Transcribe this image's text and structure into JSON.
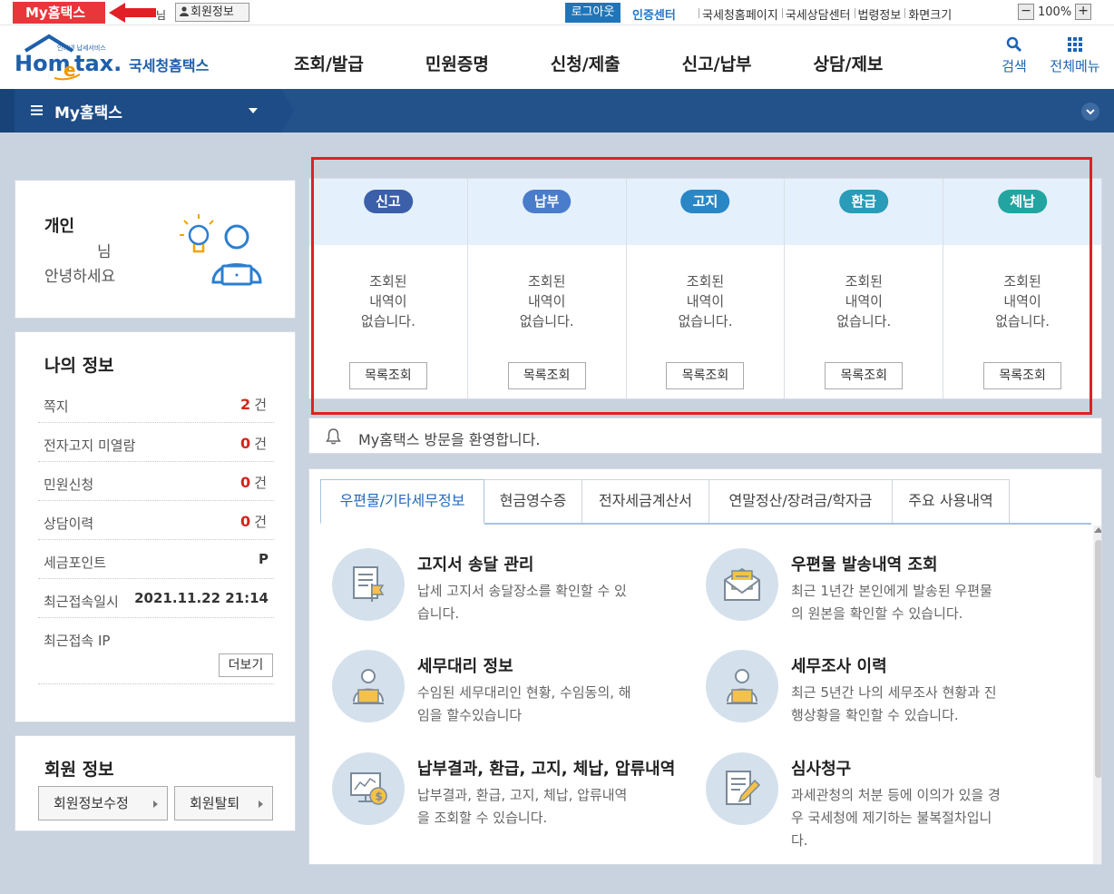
{
  "topbar": {
    "my_badge": "My홈택스",
    "nim": "님",
    "member_info": "회원정보",
    "logout": "로그아웃",
    "cert_center": "인증센터",
    "links": [
      "국세청홈페이지",
      "국세상담센터",
      "법령정보",
      "화면크기"
    ],
    "zoom_minus": "−",
    "zoom_value": "100%",
    "zoom_plus": "+"
  },
  "header": {
    "logo_tagline": "인터넷 납세서비스",
    "logo_home": "Hom",
    "logo_e": "e",
    "logo_tax": "tax.",
    "logo_kr": "국세청홈택스",
    "nav": [
      "조회/발급",
      "민원증명",
      "신청/제출",
      "신고/납부",
      "상담/제보"
    ],
    "search": "검색",
    "all_menu": "전체메뉴"
  },
  "band": {
    "title": "My홈택스"
  },
  "profile": {
    "type": "개인",
    "nim": "님",
    "greeting": "안녕하세요"
  },
  "my_info": {
    "title": "나의 정보",
    "rows": [
      {
        "label": "쪽지",
        "count": "2",
        "unit": "건"
      },
      {
        "label": "전자고지 미열람",
        "count": "0",
        "unit": "건"
      },
      {
        "label": "민원신청",
        "count": "0",
        "unit": "건"
      },
      {
        "label": "상담이력",
        "count": "0",
        "unit": "건"
      }
    ],
    "points_label": "세금포인트",
    "points_value": "P",
    "last_login_label": "최근접속일시",
    "last_login_value": "2021.11.22 21:14",
    "last_ip_label": "최근접속 IP",
    "more": "더보기"
  },
  "member": {
    "title": "회원 정보",
    "edit": "회원정보수정",
    "leave": "회원탈퇴"
  },
  "status": [
    {
      "label": "신고",
      "color": "#3b5fa8",
      "line1": "조회된",
      "line2": "내역이",
      "line3": "없습니다.",
      "button": "목록조회"
    },
    {
      "label": "납부",
      "color": "#4a7ccc",
      "line1": "조회된",
      "line2": "내역이",
      "line3": "없습니다.",
      "button": "목록조회"
    },
    {
      "label": "고지",
      "color": "#2a87c6",
      "line1": "조회된",
      "line2": "내역이",
      "line3": "없습니다.",
      "button": "목록조회"
    },
    {
      "label": "환급",
      "color": "#2a9bb8",
      "line1": "조회된",
      "line2": "내역이",
      "line3": "없습니다.",
      "button": "목록조회"
    },
    {
      "label": "체납",
      "color": "#22a5a0",
      "line1": "조회된",
      "line2": "내역이",
      "line3": "없습니다.",
      "button": "목록조회"
    }
  ],
  "notice": {
    "text": "My홈택스 방문을 환영합니다."
  },
  "tabs": [
    "우편물/기타세무정보",
    "현금영수증",
    "전자세금계산서",
    "연말정산/장려금/학자금",
    "주요 사용내역"
  ],
  "services": [
    {
      "title": "고지서 송달 관리",
      "desc_1": "납세 고지서 송달장소를 확인할 수 있",
      "desc_2": "습니다.",
      "desc_3": "",
      "icon": "document-flag-icon"
    },
    {
      "title": "우편물 발송내역 조회",
      "desc_1": "최근 1년간 본인에게 발송된 우편물",
      "desc_2": "의 원본을 확인할 수 있습니다.",
      "desc_3": "",
      "icon": "envelope-icon"
    },
    {
      "title": "세무대리 정보",
      "desc_1": "수임된 세무대리인 현황, 수임동의, 해",
      "desc_2": "임을 할수있습니다",
      "desc_3": "",
      "icon": "person-laptop-icon"
    },
    {
      "title": "세무조사 이력",
      "desc_1": "최근 5년간 나의 세무조사 현황과 진",
      "desc_2": "행상황을 확인할 수 있습니다.",
      "desc_3": "",
      "icon": "person-laptop-icon"
    },
    {
      "title": "납부결과, 환급, 고지, 체납, 압류내역",
      "desc_1": "납부결과, 환급, 고지, 체납, 압류내역",
      "desc_2": "을 조회할 수 있습니다.",
      "desc_3": "",
      "icon": "monitor-coin-icon"
    },
    {
      "title": "심사청구",
      "desc_1": "과세관청의 처분 등에 이의가 있을 경",
      "desc_2": "우 국세청에 제기하는 불복절차입니",
      "desc_3": "다.",
      "icon": "document-pen-icon"
    }
  ]
}
